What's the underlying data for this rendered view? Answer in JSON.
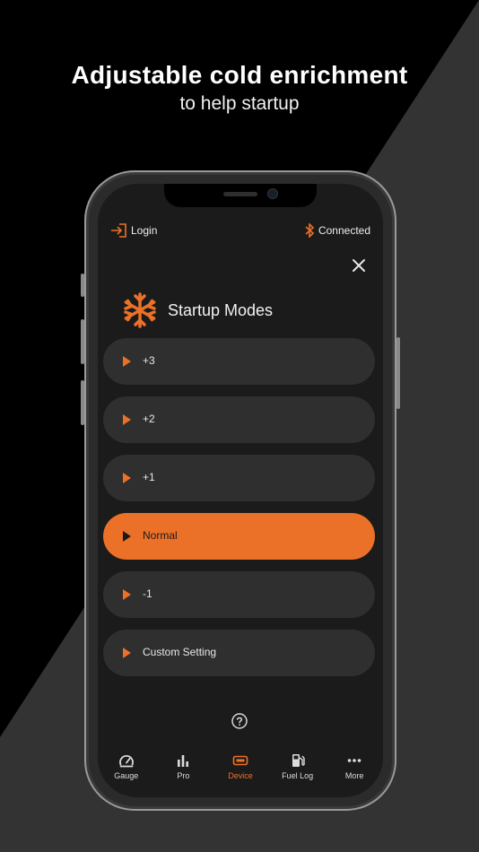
{
  "headline": "Adjustable cold enrichment",
  "subline": "to help startup",
  "colors": {
    "accent": "#ec7128",
    "background": "#000000",
    "diagonal": "#333333",
    "card": "#2f2f2f"
  },
  "topbar": {
    "login_label": "Login",
    "login_icon": "login-icon",
    "status_label": "Connected",
    "status_icon": "bluetooth-icon"
  },
  "modes": {
    "title": "Startup Modes",
    "icon": "snowflake-icon",
    "items": [
      {
        "label": "+3",
        "selected": false
      },
      {
        "label": "+2",
        "selected": false
      },
      {
        "label": "+1",
        "selected": false
      },
      {
        "label": "Normal",
        "selected": true
      },
      {
        "label": "-1",
        "selected": false
      },
      {
        "label": "Custom Setting",
        "selected": false
      }
    ]
  },
  "tabs": [
    {
      "label": "Gauge",
      "icon": "gauge-icon",
      "active": false
    },
    {
      "label": "Pro",
      "icon": "bar-chart-icon",
      "active": false
    },
    {
      "label": "Device",
      "icon": "device-icon",
      "active": true
    },
    {
      "label": "Fuel Log",
      "icon": "fuel-pump-icon",
      "active": false
    },
    {
      "label": "More",
      "icon": "more-dots-icon",
      "active": false
    }
  ]
}
